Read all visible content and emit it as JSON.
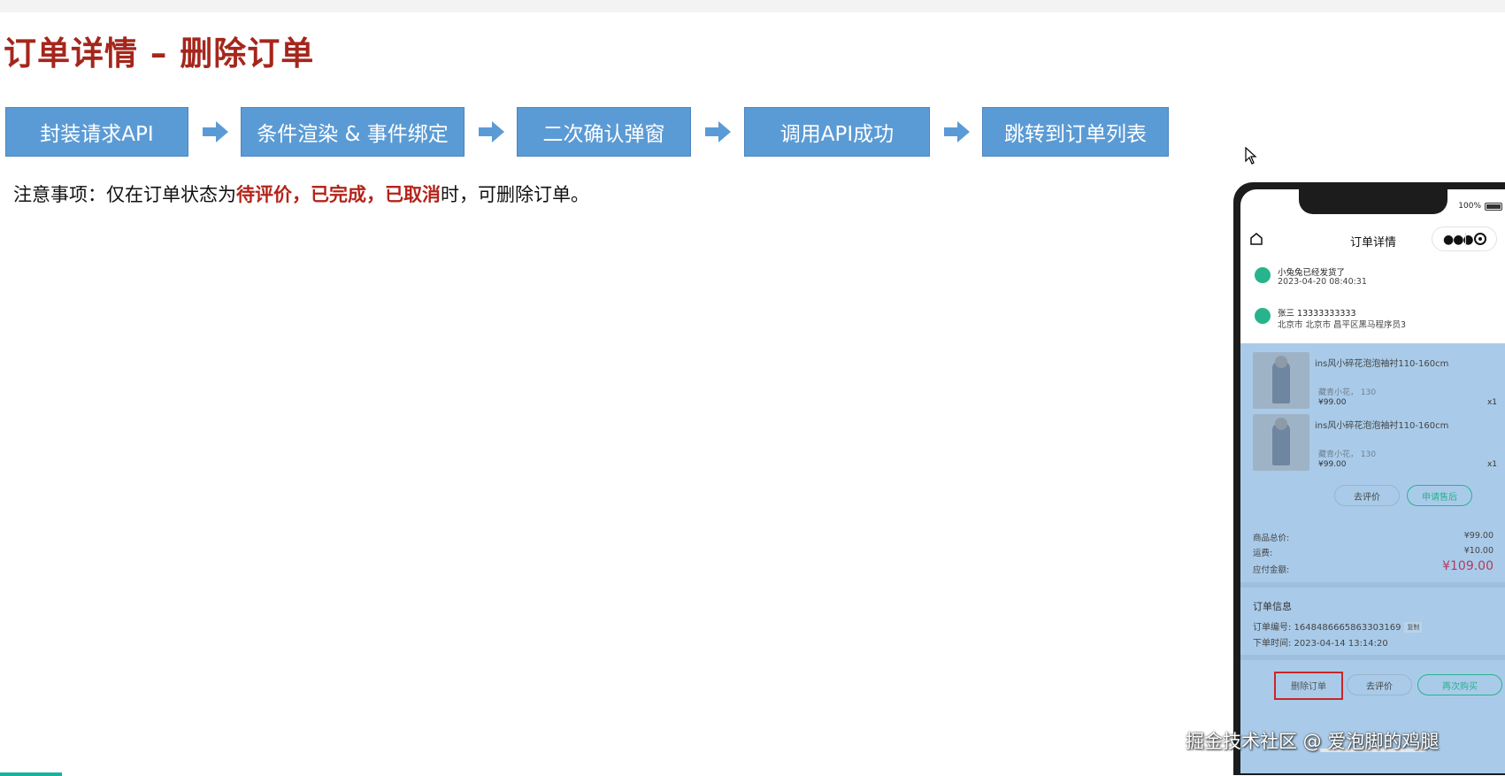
{
  "slide": {
    "title": "订单详情 – 删除订单",
    "steps": [
      "封装请求API",
      "条件渲染 & 事件绑定",
      "二次确认弹窗",
      "调用API成功",
      "跳转到订单列表"
    ],
    "note": {
      "prefix": "注意事项：仅在订单状态为",
      "status1": "待评价，",
      "status2": "已完成，",
      "status3": "已取消",
      "suffix": "时，可删除订单。"
    },
    "watermark": "掘金技术社区 @ 爱泡脚的鸡腿"
  },
  "phone": {
    "battery": "100%",
    "nav_title": "订单详情",
    "nav_more_icon": "more-dots-icon",
    "nav_home_icon": "home-icon",
    "shipping": {
      "icon": "truck-icon",
      "text": "小兔兔已经发货了",
      "time": "2023-04-20 08:40:31"
    },
    "address": {
      "icon": "location-pin-icon",
      "name_phone": "张三 13333333333",
      "detail": "北京市 北京市 昌平区黑马程序员3"
    },
    "goods": [
      {
        "name": "ins风小碎花泡泡袖衬110-160cm",
        "spec": "藏青小花， 130",
        "price": "¥99.00",
        "qty": "x1"
      },
      {
        "name": "ins风小碎花泡泡袖衬110-160cm",
        "spec": "藏青小花， 130",
        "price": "¥99.00",
        "qty": "x1"
      }
    ],
    "goods_buttons": {
      "review": "去评价",
      "after_sale": "申请售后"
    },
    "summary": {
      "goods_total_label": "商品总价:",
      "goods_total": "¥99.00",
      "freight_label": "运费:",
      "freight": "¥10.00",
      "pay_label": "应付金额:",
      "pay": "¥109.00"
    },
    "order_info": {
      "title": "订单信息",
      "order_no": "订单编号: 1648486665863303169",
      "copy": "复制",
      "order_time": "下单时间: 2023-04-14 13:14:20"
    },
    "bottom": {
      "delete": "删除订单",
      "review": "去评价",
      "rebuy": "再次购买"
    }
  },
  "colors": {
    "title_red": "#a5261c",
    "step_blue": "#5b9bd5",
    "highlight_red": "#b3241a",
    "accent_teal": "#27b38c"
  }
}
